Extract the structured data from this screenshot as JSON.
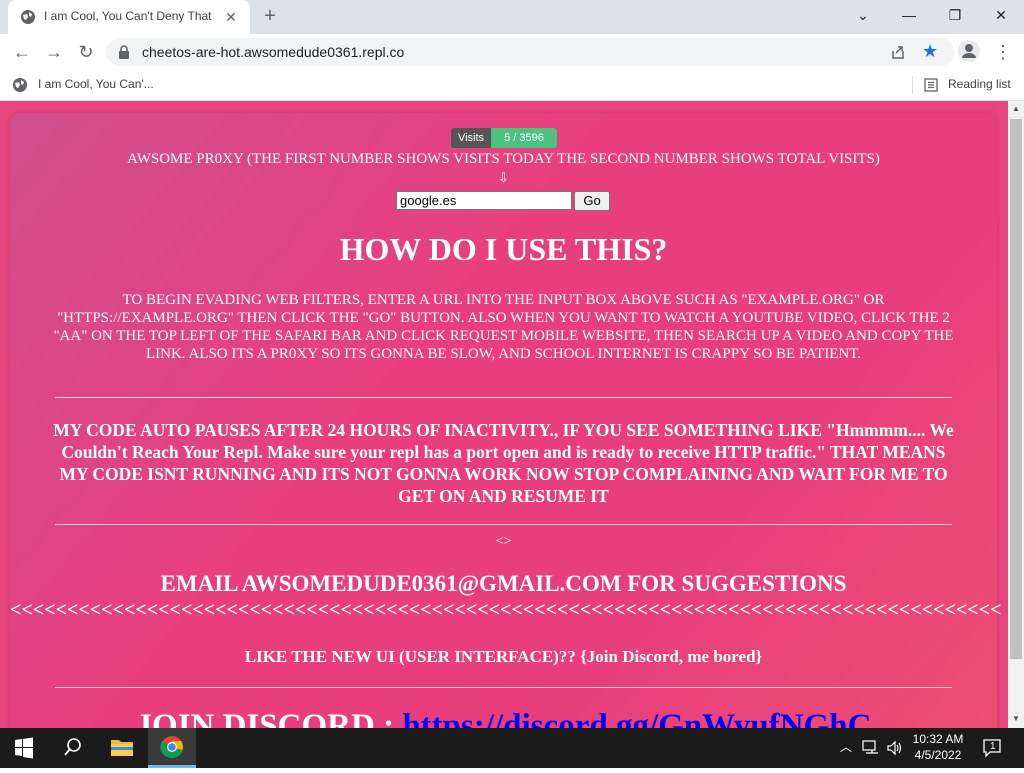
{
  "browser": {
    "tab_title": "I am Cool, You Can't Deny That",
    "new_tab_symbol": "+",
    "url": "cheetos-are-hot.awsomedude0361.repl.co",
    "bookmark_label": "I am Cool, You Can'...",
    "reading_list_label": "Reading list"
  },
  "page": {
    "visits_label": "Visits",
    "visits_value": "5 / 3596",
    "subtitle": "AWSOME PR0XY (THE FIRST NUMBER SHOWS VISITS TODAY THE SECOND NUMBER SHOWS TOTAL VISITS)",
    "arrow": "⇩",
    "search_value": "google.es",
    "go_label": "Go",
    "howto_heading": "HOW DO I USE THIS?",
    "howto_text": "TO BEGIN EVADING WEB FILTERS, ENTER A URL INTO THE INPUT BOX ABOVE SUCH AS \"EXAMPLE.ORG\" OR \"HTTPS://EXAMPLE.ORG\" THEN CLICK THE \"GO\" BUTTON. ALSO WHEN YOU WANT TO WATCH A YOUTUBE VIDEO, CLICK THE 2 \"AA\" ON THE TOP LEFT OF THE SAFARI BAR AND CLICK REQUEST MOBILE WEBSITE, THEN SEARCH UP A VIDEO AND COPY THE LINK. ALSO ITS A PR0XY SO ITS GONNA BE SLOW, AND SCHOOL INTERNET IS CRAPPY SO BE PATIENT.",
    "warning_text": "MY CODE AUTO PAUSES AFTER 24 HOURS OF INACTIVITY., IF YOU SEE SOMETHING LIKE \"Hmmmm.... We Couldn't Reach Your Repl. Make sure your repl has a port open and is ready to receive HTTP traffic.\" THAT MEANS MY CODE ISNT RUNNING AND ITS NOT GONNA WORK NOW STOP COMPLAINING AND WAIT FOR ME TO GET ON AND RESUME IT",
    "small_glyph": "<>",
    "email_heading": "EMAIL AWSOMEDUDE0361@GMAIL.COM FOR SUGGESTIONS",
    "arrows_line": "<<<<<<<<<<<<<<<<<<<<<<<<<<<<<<<<<<<<<<<<<<<<<<<<<<<<<<<<<<<<<<<<<<<<<<<<<<<<<<<<<<<<<<<",
    "newui_text": "LIKE THE NEW UI (USER INTERFACE)?? {Join Discord, me bored}",
    "discord_prefix": "JOIN DISCORD : ",
    "discord_link": "https://discord.gg/GnWyufNGhC"
  },
  "taskbar": {
    "time": "10:32 AM",
    "date": "4/5/2022",
    "notification_count": "1"
  },
  "colors": {
    "page_background": "#e8457e",
    "visits_badge": "#4bc27d",
    "link": "#0000ee"
  }
}
